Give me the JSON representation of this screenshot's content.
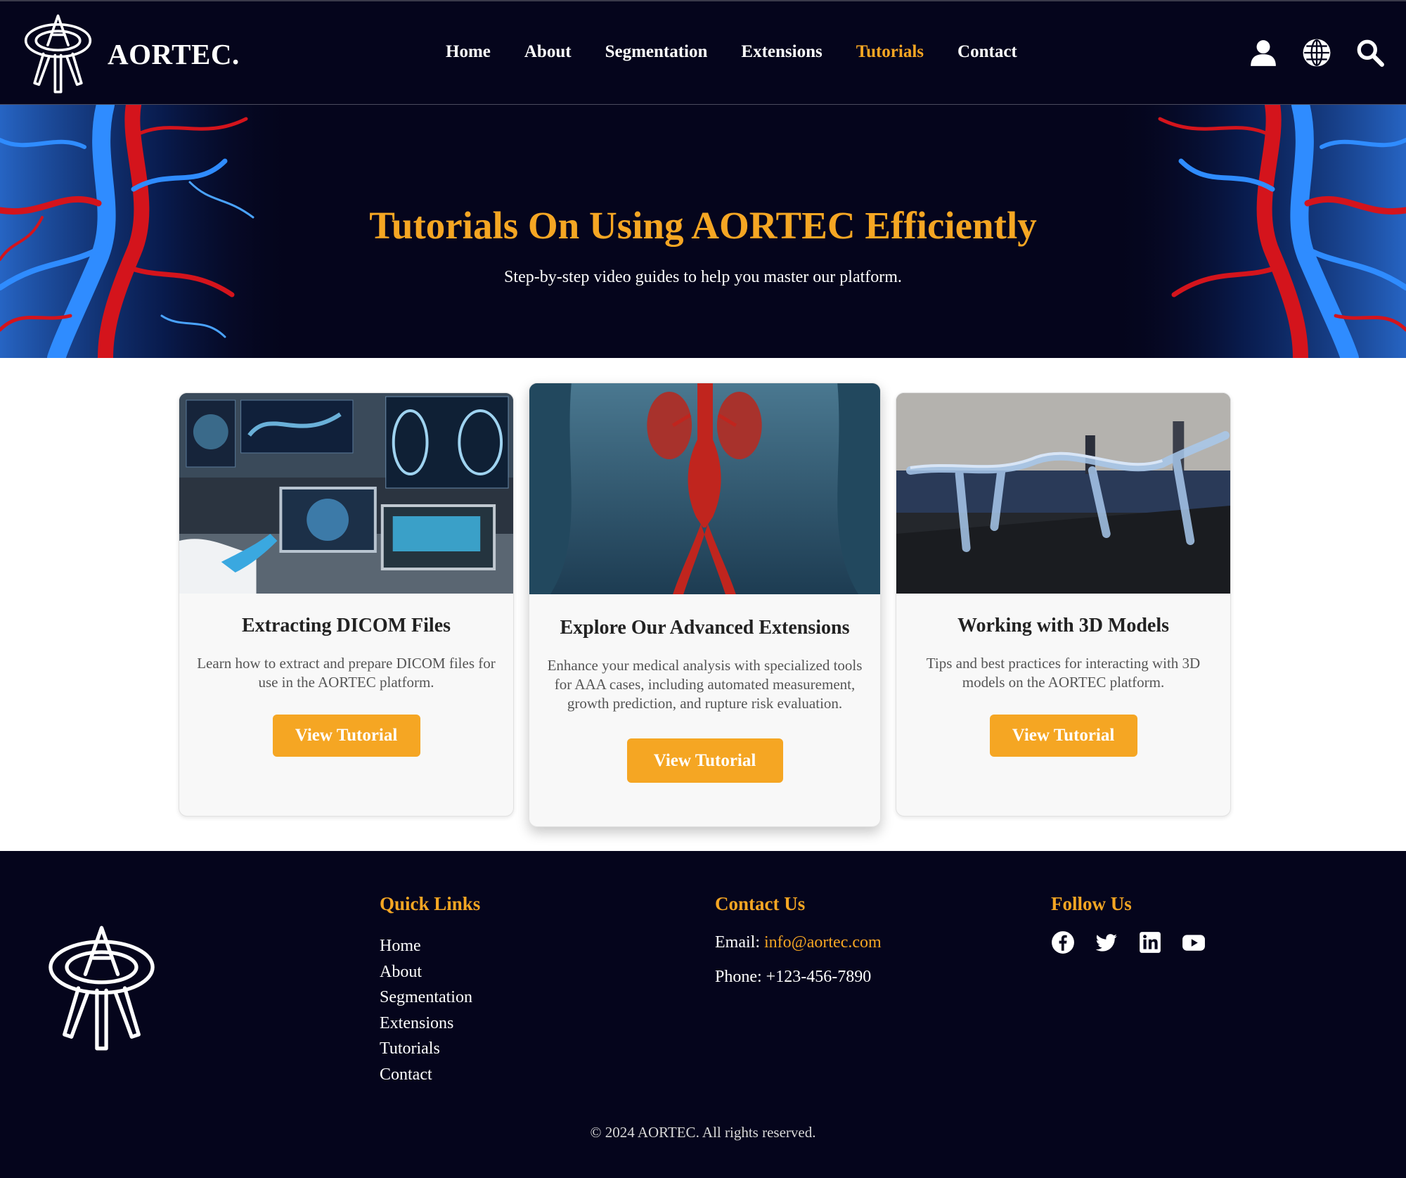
{
  "brand": {
    "name": "AORTEC.",
    "logo_icon": "aortec-logo-icon"
  },
  "nav": {
    "items": [
      {
        "label": "Home",
        "active": false
      },
      {
        "label": "About",
        "active": false
      },
      {
        "label": "Segmentation",
        "active": false
      },
      {
        "label": "Extensions",
        "active": false
      },
      {
        "label": "Tutorials",
        "active": true
      },
      {
        "label": "Contact",
        "active": false
      }
    ],
    "icons": [
      "user-icon",
      "globe-icon",
      "search-icon"
    ]
  },
  "hero": {
    "title": "Tutorials On Using AORTEC Efficiently",
    "subtitle": "Step-by-step video guides to help you master our platform."
  },
  "cards": [
    {
      "image": "lab-imaging-image",
      "title": "Extracting DICOM Files",
      "text": "Learn how to extract and prepare DICOM files for use in the AORTEC platform.",
      "button": "View Tutorial"
    },
    {
      "image": "aorta-kidney-image",
      "title": "Explore Our Advanced Extensions",
      "text": "Enhance your medical analysis with specialized tools for AAA cases, including automated measurement, growth prediction, and rupture risk evaluation.",
      "button": "View Tutorial"
    },
    {
      "image": "3d-vessel-model-image",
      "title": "Working with 3D Models",
      "text": "Tips and best practices for interacting with 3D models on the AORTEC platform.",
      "button": "View Tutorial"
    }
  ],
  "footer": {
    "quick_links": {
      "heading": "Quick Links",
      "items": [
        "Home",
        "About",
        "Segmentation",
        "Extensions",
        "Tutorials",
        "Contact"
      ]
    },
    "contact": {
      "heading": "Contact Us",
      "email_label": "Email:",
      "email": "info@aortec.com",
      "phone_label": "Phone:",
      "phone": "+123-456-7890"
    },
    "follow": {
      "heading": "Follow Us",
      "icons": [
        "facebook-icon",
        "twitter-icon",
        "linkedin-icon",
        "youtube-icon"
      ]
    },
    "copyright": "© 2024 AORTEC. All rights reserved."
  },
  "colors": {
    "background_dark": "#05051c",
    "accent": "#f5a623",
    "card_bg": "#f8f8f8"
  }
}
